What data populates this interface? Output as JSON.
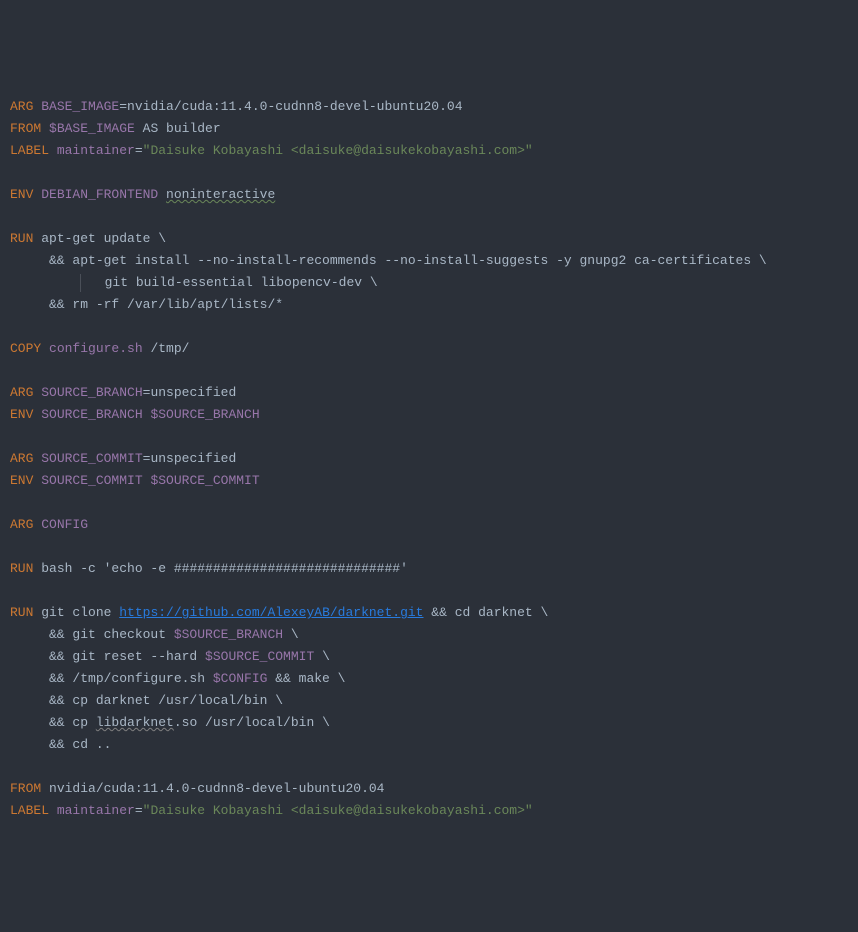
{
  "lines": [
    {
      "type": "arg1",
      "k": "ARG ",
      "a": "BASE_IMAGE",
      "eq": "=nvidia/cuda:11.4.0-cudnn8-devel-ubuntu20.04"
    },
    {
      "type": "from1",
      "k": "FROM ",
      "v": "$BASE_IMAGE",
      "r": " AS builder"
    },
    {
      "type": "label",
      "k": "LABEL ",
      "a": "maintainer",
      "eq": "=",
      "s": "\"Daisuke Kobayashi <daisuke@daisukekobayashi.com>\""
    },
    {
      "type": "blank"
    },
    {
      "type": "env1",
      "k": "ENV ",
      "a": "DEBIAN_FRONTEND ",
      "val": "noninteractive"
    },
    {
      "type": "blank"
    },
    {
      "type": "run",
      "k": "RUN ",
      "r": "apt-get update \\"
    },
    {
      "type": "cont",
      "r": "     && apt-get install --no-install-recommends --no-install-suggests -y gnupg2 ca-certificates \\"
    },
    {
      "type": "cont-pipe",
      "r": "git build-essential libopencv-dev \\"
    },
    {
      "type": "cont",
      "r": "     && rm -rf /var/lib/apt/lists/*"
    },
    {
      "type": "blank"
    },
    {
      "type": "copy",
      "k": "COPY ",
      "a": "configure.sh",
      "r": " /tmp/"
    },
    {
      "type": "blank"
    },
    {
      "type": "arg1",
      "k": "ARG ",
      "a": "SOURCE_BRANCH",
      "eq": "=unspecified"
    },
    {
      "type": "env2",
      "k": "ENV ",
      "a": "SOURCE_BRANCH ",
      "v": "$SOURCE_BRANCH"
    },
    {
      "type": "blank"
    },
    {
      "type": "arg1",
      "k": "ARG ",
      "a": "SOURCE_COMMIT",
      "eq": "=unspecified"
    },
    {
      "type": "env2",
      "k": "ENV ",
      "a": "SOURCE_COMMIT ",
      "v": "$SOURCE_COMMIT"
    },
    {
      "type": "blank"
    },
    {
      "type": "arg2",
      "k": "ARG ",
      "a": "CONFIG"
    },
    {
      "type": "blank"
    },
    {
      "type": "run",
      "k": "RUN ",
      "r": "bash -c 'echo -e #############################'"
    },
    {
      "type": "blank"
    },
    {
      "type": "git",
      "k": "RUN ",
      "r1": "git clone ",
      "url": "https://github.com/AlexeyAB/darknet.git",
      "r2": " && cd darknet \\"
    },
    {
      "type": "cont-var",
      "r1": "     && git checkout ",
      "v": "$SOURCE_BRANCH",
      "r2": " \\"
    },
    {
      "type": "cont-var",
      "r1": "     && git reset --hard ",
      "v": "$SOURCE_COMMIT",
      "r2": " \\"
    },
    {
      "type": "cont-var",
      "r1": "     && /tmp/configure.sh ",
      "v": "$CONFIG",
      "r2": " && make \\"
    },
    {
      "type": "cont",
      "r": "     && cp darknet /usr/local/bin \\"
    },
    {
      "type": "cont-typo",
      "r1": "     && cp ",
      "typo": "libdarknet",
      "r2": ".so /usr/local/bin \\"
    },
    {
      "type": "cont",
      "r": "     && cd .."
    },
    {
      "type": "blank"
    },
    {
      "type": "from2",
      "k": "FROM ",
      "r": "nvidia/cuda:11.4.0-cudnn8-devel-ubuntu20.04"
    },
    {
      "type": "label",
      "k": "LABEL ",
      "a": "maintainer",
      "eq": "=",
      "s": "\"Daisuke Kobayashi <daisuke@daisukekobayashi.com>\""
    }
  ]
}
